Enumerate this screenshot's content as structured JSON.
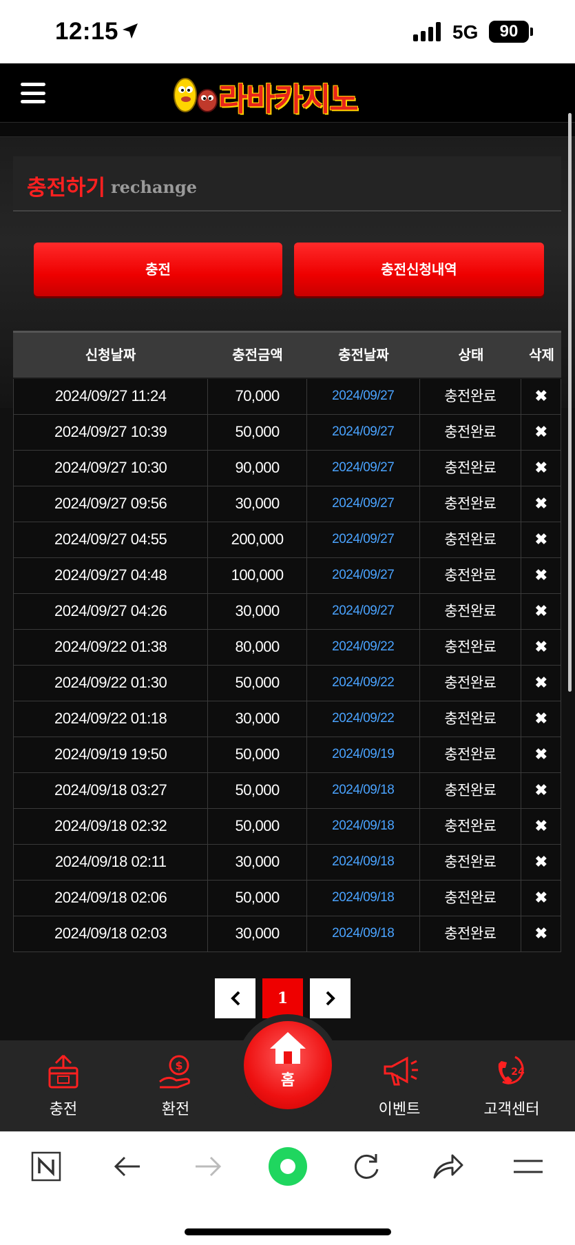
{
  "status_bar": {
    "time": "12:15",
    "network": "5G",
    "battery": "90"
  },
  "header": {
    "logo_text": "라바카지노"
  },
  "title": {
    "main": "충전하기",
    "sub": "rechange"
  },
  "buttons": {
    "charge": "충전",
    "history": "충전신청내역"
  },
  "table": {
    "headers": [
      "신청날짜",
      "충전금액",
      "충전날짜",
      "상태",
      "삭제"
    ],
    "rows": [
      {
        "requested": "2024/09/27 11:24",
        "amount": "70,000",
        "date": "2024/09/27",
        "status": "충전완료",
        "delete": "✖"
      },
      {
        "requested": "2024/09/27 10:39",
        "amount": "50,000",
        "date": "2024/09/27",
        "status": "충전완료",
        "delete": "✖"
      },
      {
        "requested": "2024/09/27 10:30",
        "amount": "90,000",
        "date": "2024/09/27",
        "status": "충전완료",
        "delete": "✖"
      },
      {
        "requested": "2024/09/27 09:56",
        "amount": "30,000",
        "date": "2024/09/27",
        "status": "충전완료",
        "delete": "✖"
      },
      {
        "requested": "2024/09/27 04:55",
        "amount": "200,000",
        "date": "2024/09/27",
        "status": "충전완료",
        "delete": "✖"
      },
      {
        "requested": "2024/09/27 04:48",
        "amount": "100,000",
        "date": "2024/09/27",
        "status": "충전완료",
        "delete": "✖"
      },
      {
        "requested": "2024/09/27 04:26",
        "amount": "30,000",
        "date": "2024/09/27",
        "status": "충전완료",
        "delete": "✖"
      },
      {
        "requested": "2024/09/22 01:38",
        "amount": "80,000",
        "date": "2024/09/22",
        "status": "충전완료",
        "delete": "✖"
      },
      {
        "requested": "2024/09/22 01:30",
        "amount": "50,000",
        "date": "2024/09/22",
        "status": "충전완료",
        "delete": "✖"
      },
      {
        "requested": "2024/09/22 01:18",
        "amount": "30,000",
        "date": "2024/09/22",
        "status": "충전완료",
        "delete": "✖"
      },
      {
        "requested": "2024/09/19 19:50",
        "amount": "50,000",
        "date": "2024/09/19",
        "status": "충전완료",
        "delete": "✖"
      },
      {
        "requested": "2024/09/18 03:27",
        "amount": "50,000",
        "date": "2024/09/18",
        "status": "충전완료",
        "delete": "✖"
      },
      {
        "requested": "2024/09/18 02:32",
        "amount": "50,000",
        "date": "2024/09/18",
        "status": "충전완료",
        "delete": "✖"
      },
      {
        "requested": "2024/09/18 02:11",
        "amount": "30,000",
        "date": "2024/09/18",
        "status": "충전완료",
        "delete": "✖"
      },
      {
        "requested": "2024/09/18 02:06",
        "amount": "50,000",
        "date": "2024/09/18",
        "status": "충전완료",
        "delete": "✖"
      },
      {
        "requested": "2024/09/18 02:03",
        "amount": "30,000",
        "date": "2024/09/18",
        "status": "충전완료",
        "delete": "✖"
      }
    ]
  },
  "pagination": {
    "current": "1"
  },
  "bottom_nav": {
    "charge": "충전",
    "exchange": "환전",
    "home": "홈",
    "event": "이벤트",
    "support": "고객센터",
    "support_badge": "24"
  },
  "icons": [
    "location-arrow-icon",
    "hamburger-menu-icon",
    "chevron-left-icon",
    "chevron-right-icon",
    "home-icon",
    "box-upload-icon",
    "coin-hand-icon",
    "megaphone-icon",
    "phone-24-icon",
    "naver-icon",
    "back-arrow-icon",
    "forward-arrow-icon",
    "green-circle-icon",
    "reload-icon",
    "share-icon",
    "menu-icon"
  ],
  "colors": {
    "accent_red": "#ee0000",
    "link_blue": "#4aa3ff",
    "background": "#111111",
    "nav_bg": "#262626",
    "browser_green": "#1fd65f"
  }
}
